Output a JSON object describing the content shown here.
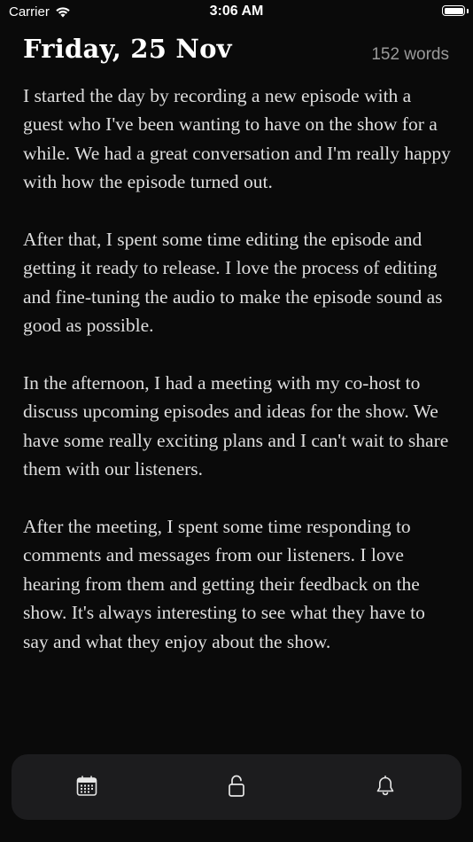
{
  "status_bar": {
    "carrier": "Carrier",
    "time": "3:06 AM",
    "battery_level": 1.0
  },
  "entry": {
    "title": "Friday, 25 Nov",
    "word_count": "152 words",
    "paragraphs": [
      "I started the day by recording a new episode with a guest who I've been wanting to have on the show for a while. We had a great conversation and I'm really happy with how the episode turned out.",
      "After that, I spent some time editing the episode and getting it ready to release. I love the process of editing and fine-tuning the audio to make the episode sound as good as possible.",
      "In the afternoon, I had a meeting with my co-host to discuss upcoming episodes and ideas for the show. We have some really exciting plans and I can't wait to share them with our listeners.",
      "After the meeting, I spent some time responding to comments and messages from our listeners. I love hearing from them and getting their feedback on the show. It's always interesting to see what they have to say and what they enjoy about the show."
    ]
  },
  "toolbar": {
    "items": [
      {
        "icon": "calendar-icon"
      },
      {
        "icon": "unlocked-padlock-icon"
      },
      {
        "icon": "bell-icon"
      }
    ]
  },
  "colors": {
    "background": "#0a0a0a",
    "toolbar": "#1c1c1e",
    "text": "#dedede",
    "muted": "#9a9a9a"
  }
}
